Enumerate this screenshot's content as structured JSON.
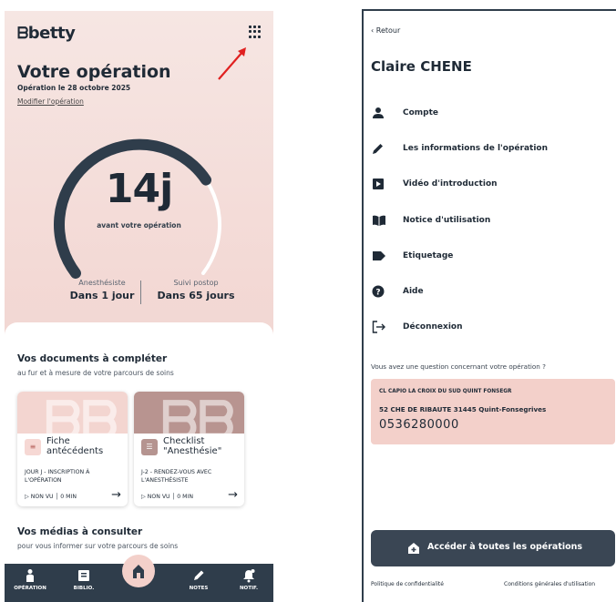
{
  "left": {
    "brand": "betty",
    "operation": {
      "title": "Votre opération",
      "date": "Opération le 28 octobre 2025",
      "edit_link": "Modifier l'opération"
    },
    "countdown": {
      "value": "14j",
      "subtitle": "avant votre opération",
      "progress": 0.72
    },
    "stats": [
      {
        "label": "Anesthésiste",
        "value": "Dans 1 jour"
      },
      {
        "label": "Suivi postop",
        "value": "Dans 65 jours"
      }
    ],
    "documents": {
      "title": "Vos documents à compléter",
      "subtitle": "au fur et à mesure de votre parcours de soins",
      "cards": [
        {
          "title": "Fiche antécédents",
          "meta": "Jour J - Inscription à l'opération",
          "status": "NON VU",
          "duration": "0 MIN"
        },
        {
          "title": "Checklist \"Anesthésie\"",
          "meta": "J-2 - Rendez-vous avec l'anesthésiste",
          "status": "NON VU",
          "duration": "0 MIN"
        }
      ]
    },
    "medias": {
      "title": "Vos médias à consulter",
      "subtitle": "pour vous informer sur votre parcours de soins"
    },
    "tabs": [
      {
        "label": "OPÉRATION",
        "icon": "operation-icon"
      },
      {
        "label": "BIBLIO.",
        "icon": "book-icon"
      },
      {
        "label": "",
        "icon": "home-icon"
      },
      {
        "label": "NOTES",
        "icon": "pencil-icon"
      },
      {
        "label": "NOTIF.",
        "icon": "bell-icon"
      }
    ],
    "colors": {
      "accent": "#2f3d4b",
      "pink": "#f3d0ca"
    }
  },
  "right": {
    "back": "Retour",
    "user_name": "Claire CHENE",
    "menu": [
      {
        "label": "Compte",
        "icon": "person-icon"
      },
      {
        "label": "Les informations de l'opération",
        "icon": "pencil-icon"
      },
      {
        "label": "Vidéo d'introduction",
        "icon": "play-icon"
      },
      {
        "label": "Notice d'utilisation",
        "icon": "book-open-icon"
      },
      {
        "label": "Etiquetage",
        "icon": "label-icon"
      },
      {
        "label": "Aide",
        "icon": "help-icon"
      },
      {
        "label": "Déconnexion",
        "icon": "logout-icon"
      }
    ],
    "question": "Vous avez une question concernant votre opération ?",
    "clinic": {
      "name": "CL CAPIO LA CROIX DU SUD QUINT FONSEGR",
      "address": "52 CHE DE RIBAUTE 31445 Quint-Fonsegrives",
      "phone": "0536280000"
    },
    "all_operations": "Accéder à toutes les opérations",
    "privacy": "Politique de confidentialité",
    "terms": "Conditions générales d'utilisation"
  }
}
